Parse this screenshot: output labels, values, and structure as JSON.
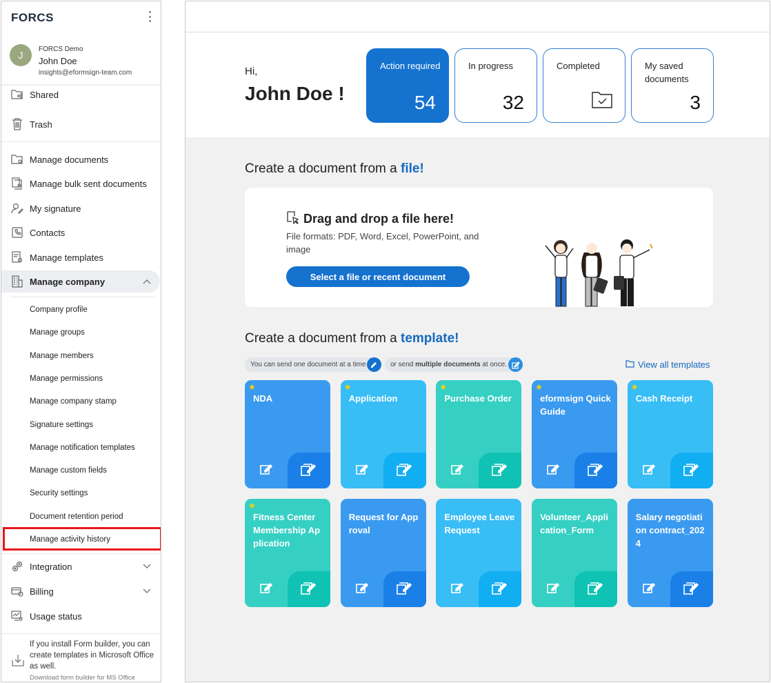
{
  "app": {
    "logo": "FORCS"
  },
  "profile": {
    "avatar_letter": "J",
    "company": "FORCS Demo",
    "name": "John Doe",
    "email": "insights@eformsign-team.com"
  },
  "nav": {
    "shared": "Shared",
    "trash": "Trash",
    "manage_documents": "Manage documents",
    "manage_bulk": "Manage bulk sent documents",
    "my_signature": "My signature",
    "contacts": "Contacts",
    "manage_templates": "Manage templates",
    "manage_company": "Manage company",
    "company_sub": [
      "Company profile",
      "Manage groups",
      "Manage members",
      "Manage permissions",
      "Manage company stamp",
      "Signature settings",
      "Manage notification templates",
      "Manage custom fields",
      "Security settings",
      "Document retention period",
      "Manage activity history"
    ],
    "integration": "Integration",
    "billing": "Billing",
    "usage_status": "Usage status"
  },
  "footer": {
    "note": "If you install Form builder, you can create templates in Microsoft Office as well.",
    "link": "Download form builder for MS Office"
  },
  "hero": {
    "greeting": "Hi,",
    "name": "John Doe !",
    "stats": [
      {
        "label": "Action required",
        "value": "54"
      },
      {
        "label": "In progress",
        "value": "32"
      },
      {
        "label": "Completed",
        "value": ""
      },
      {
        "label": "My saved documents",
        "value": "3"
      }
    ]
  },
  "file_section": {
    "title_prefix": "Create a document from a ",
    "title_highlight": "file!",
    "drop_title": "Drag and drop a file here!",
    "drop_sub": "File formats: PDF, Word, Excel, PowerPoint, and image",
    "select_button": "Select a file or recent document"
  },
  "template_section": {
    "title_prefix": "Create a document from a ",
    "title_highlight": "template!",
    "pill_one_prefix": "You can send one document at a time",
    "pill_multi_prefix": "or send ",
    "pill_multi_bold": "multiple documents",
    "pill_multi_suffix": " at once.",
    "view_all": "View all templates",
    "cards": [
      {
        "title": "NDA",
        "starred": true,
        "color": "blue"
      },
      {
        "title": "Application",
        "starred": true,
        "color": "sky"
      },
      {
        "title": "Purchase Order",
        "starred": true,
        "color": "teal"
      },
      {
        "title": "eformsign Quick Guide",
        "starred": true,
        "color": "blue"
      },
      {
        "title": "Cash Receipt",
        "starred": true,
        "color": "sky"
      },
      {
        "title": "Fitness Center Membership Ap plication",
        "starred": true,
        "color": "teal"
      },
      {
        "title": "Request for App roval",
        "starred": false,
        "color": "blue"
      },
      {
        "title": "Employee Leave Request",
        "starred": false,
        "color": "sky"
      },
      {
        "title": "Volunteer_Appli cation_Form",
        "starred": false,
        "color": "teal"
      },
      {
        "title": "Salary negotiati on contract_202 4",
        "starred": false,
        "color": "blue"
      }
    ]
  },
  "colors": {
    "primary": "#1572cf",
    "highlight_box": "#e8151b",
    "card_blue": "#3a9af0",
    "card_sky": "#38bdf5",
    "card_teal": "#35d0c3",
    "star": "#ffd200"
  }
}
